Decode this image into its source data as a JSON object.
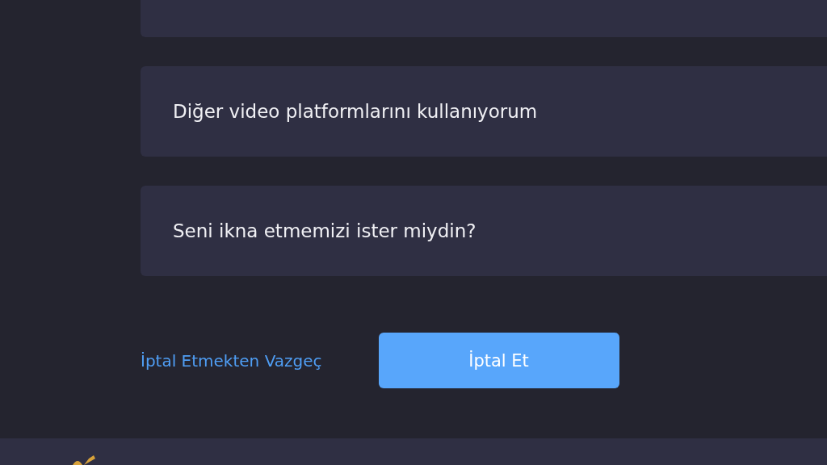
{
  "options": [
    {
      "label": "Diğer video platformlarını kullanıyorum"
    },
    {
      "label": "Seni ikna etmemizi ister miydin?"
    }
  ],
  "actions": {
    "back_link": "İptal Etmekten Vazgeç",
    "confirm_button": "İptal Et"
  }
}
